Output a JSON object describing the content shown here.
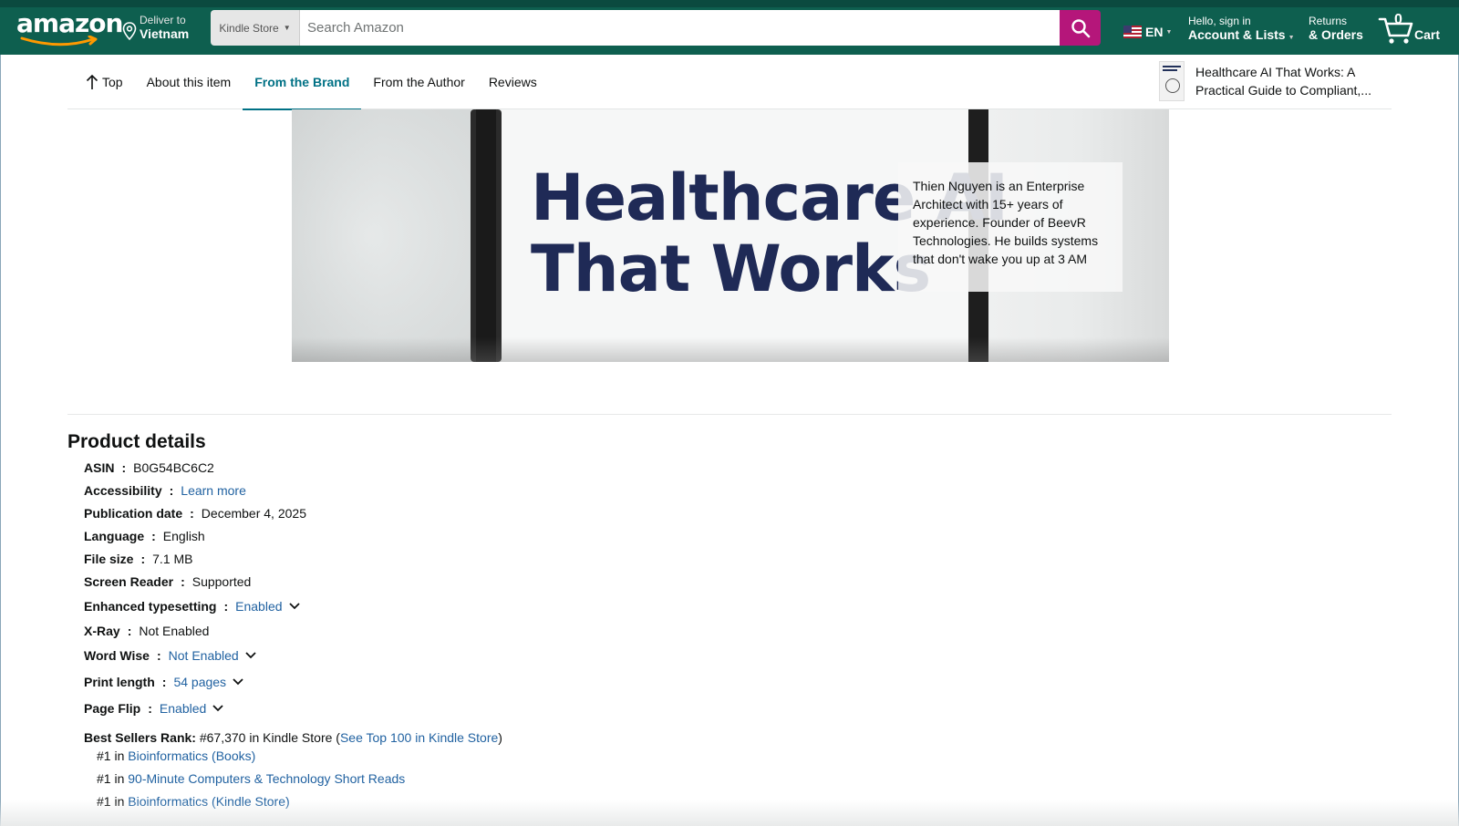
{
  "header": {
    "logo_text": "amazon",
    "deliver_small": "Deliver to",
    "deliver_location": "Vietnam",
    "search_category": "Kindle Store",
    "search_placeholder": "Search Amazon",
    "language": "EN",
    "account_small": "Hello, sign in",
    "account_big": "Account & Lists",
    "returns_small": "Returns",
    "returns_big": "& Orders",
    "cart_count": "0",
    "cart_label": "Cart"
  },
  "subnav": {
    "tabs": [
      {
        "label": "Top"
      },
      {
        "label": "About this item"
      },
      {
        "label": "From the Brand",
        "active": true
      },
      {
        "label": "From the Author"
      },
      {
        "label": "Reviews"
      }
    ],
    "product_title": "Healthcare AI That Works: A Practical Guide to Compliant,..."
  },
  "banner": {
    "title_line1": "Healthcare AI",
    "title_line2": "That Works",
    "author_bio": "Thien Nguyen is an Enterprise Architect with 15+ years of experience. Founder of BeevR Technologies. He builds systems that don't wake you up at 3 AM"
  },
  "product_details": {
    "heading": "Product details",
    "rows": [
      {
        "key": "ASIN",
        "value": "B0G54BC6C2",
        "link": false
      },
      {
        "key": "Accessibility",
        "value": "Learn more",
        "link": true
      },
      {
        "key": "Publication date",
        "value": "December 4, 2025",
        "link": false
      },
      {
        "key": "Language",
        "value": "English",
        "link": false
      },
      {
        "key": "File size",
        "value": "7.1 MB",
        "link": false
      },
      {
        "key": "Screen Reader",
        "value": "Supported",
        "link": false
      },
      {
        "key": "Enhanced typesetting",
        "value": "Enabled",
        "link": true,
        "dropdown": true
      },
      {
        "key": "X-Ray",
        "value": "Not Enabled",
        "link": false
      },
      {
        "key": "Word Wise",
        "value": "Not Enabled",
        "link": true,
        "dropdown": true
      },
      {
        "key": "Print length",
        "value": "54 pages",
        "link": true,
        "dropdown": true
      },
      {
        "key": "Page Flip",
        "value": "Enabled",
        "link": true,
        "dropdown": true
      }
    ],
    "best_sellers": {
      "key": "Best Sellers Rank:",
      "rank_text": "#67,370 in Kindle Store (",
      "link": "See Top 100 in Kindle Store",
      "close": ")",
      "subranks": [
        {
          "prefix": "#1 in ",
          "link": "Bioinformatics (Books)"
        },
        {
          "prefix": "#1 in ",
          "link": "90-Minute Computers & Technology Short Reads"
        },
        {
          "prefix": "#1 in ",
          "link": "Bioinformatics (Kindle Store)"
        }
      ]
    }
  },
  "colors": {
    "nav_bg": "#0e5f4f",
    "search_button": "#b5167a",
    "link": "#2162a1",
    "active_tab": "#007185"
  }
}
